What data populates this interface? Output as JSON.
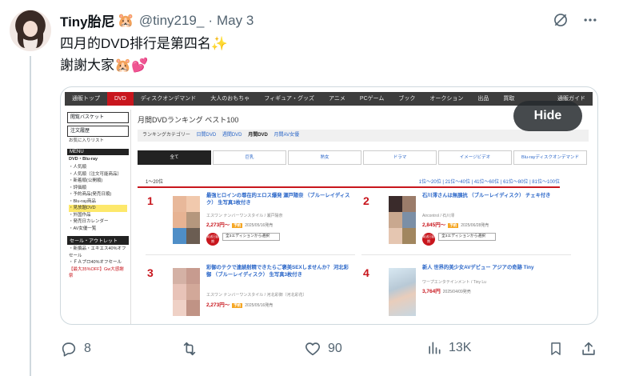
{
  "tweet": {
    "author_name": "Tiny胎尼",
    "name_emoji": "🐹",
    "handle": "@tiny219_",
    "separator": "·",
    "date": "May 3",
    "text_line1": "四月的DVD排行是第四名✨",
    "text_line2": "謝謝大家🐹💕"
  },
  "media": {
    "hide_label": "Hide",
    "shop": {
      "nav": [
        "通販トップ",
        "DVD",
        "ディスクオンデマンド",
        "大人のおもちゃ",
        "フィギュア・グッズ",
        "アニメ",
        "PCゲーム",
        "ブック",
        "オークション",
        "出品",
        "買取"
      ],
      "nav_guide": "通販ガイド",
      "side_basket": "閲覧バスケット",
      "side_history": "注文履歴",
      "side_favorites": "お気に入りリスト",
      "side_menu_head": "MENU",
      "side_menu_title": "DVD・Blu-ray",
      "side_menu_items": [
        "・人気順",
        "・人気順（注文可能商品）",
        "・新着順(公開順)",
        "・評価順",
        "・予約商品(発売日順)",
        "・Blu-ray商品",
        "・見放題DVD",
        "・外国作品",
        "・発売日カレンダー",
        "・AV女優一覧"
      ],
      "side_sale_head": "セール・アウトレット",
      "side_sale_items": [
        "・新撰品・エキエス40%オフセール",
        "・ＦＡプロ40%オフセール",
        "【最大35%OFF】Gw大感謝祭"
      ],
      "breadcrumb": "月間DVDランキング ベスト100",
      "cat_label": "ランキングカテゴリー",
      "cat_links": [
        "日間DVD",
        "週間DVD"
      ],
      "cat_current": "月間DVD",
      "cat_last": "月間AV女優",
      "tabs": [
        "全て",
        "巨乳",
        "熟女",
        "ドラマ",
        "イメージビデオ",
        "Blu-rayディスクオンデマンド"
      ],
      "range": "1〜20位",
      "pages": "1位〜20位 | 21位〜40位 | 41位〜60位 | 61位〜80位 | 81位〜100位",
      "items": [
        {
          "rank": "1",
          "title": "最強ヒロインの尊在的エロス爆発 瀬戸陽奈 （ブルーレイディスク） 生写真3枚付き",
          "maker": "エスワン ナンバーワンスタイル / 瀬戸陽奈",
          "price": "2,273円〜",
          "date": "2025/05/16発売",
          "tag": "予約",
          "select": "全3エディションから選択",
          "badge": "発送日延期"
        },
        {
          "rank": "2",
          "title": "石川澪さんは無胰抗 （ブルーレイディスク） チェキ付き",
          "maker": "Aircontrol / 石川澪",
          "price": "2,845円〜",
          "date": "2025/06/28発売",
          "tag": "予約",
          "select": "全3エディションから選択",
          "badge": "発送日延期"
        },
        {
          "rank": "3",
          "title": "彩御のテクで連続射精できたらご褒美SEXしませんか？ 河北彩御 （ブルーレイディスク） 生写真3枚付き",
          "maker": "エスワン ナンバーワンスタイル / 河北彩御（河北彩花）",
          "price": "2,273円〜",
          "date": "2025/05/16発売",
          "tag": "予約",
          "select": "",
          "badge": ""
        },
        {
          "rank": "4",
          "title": "新人 世界的美少女AVデビュー アジアの奇跡 Tiny",
          "maker": "ワープエンタテインメント / Tiny Lu",
          "price": "3,764円",
          "date": "2025/04/09発売",
          "tag": "",
          "select": "",
          "badge": ""
        }
      ]
    }
  },
  "actions": {
    "replies": "8",
    "reposts": "",
    "likes": "90",
    "views": "13K"
  }
}
